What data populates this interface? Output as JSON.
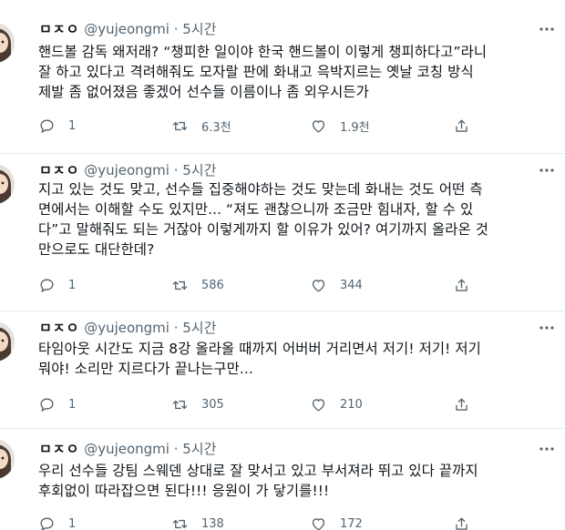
{
  "tweets": [
    {
      "display_name": "ㅁㅈㅇ",
      "handle_time": "@yujeongmi · 5시간",
      "text": "핸드볼 감독 왜저래? “챙피한 일이야 한국 핸드볼이 이렇게 챙피하다고”라니\n잘 하고 있다고 격려해줘도 모자랄 판에 화내고 윽박지르는 옛날 코칭 방식\n제발 좀 없어졌음 좋겠어 선수들 이름이나 좀 외우시든가",
      "replies": "1",
      "retweets": "6.3천",
      "likes": "1.9천"
    },
    {
      "display_name": "ㅁㅈㅇ",
      "handle_time": "@yujeongmi · 5시간",
      "text": "지고 있는 것도 맞고, 선수들 집중해야하는 것도 맞는데 화내는 것도 어떤 측\n면에서는 이해할 수도 있지만... “져도 괜찮으니까 조금만 힘내자, 할 수 있\n다”고 말해줘도 되는 거잖아 이렇게까지 할 이유가 있어? 여기까지 올라온 것\n만으로도 대단한데?",
      "replies": "1",
      "retweets": "586",
      "likes": "344"
    },
    {
      "display_name": "ㅁㅈㅇ",
      "handle_time": "@yujeongmi · 5시간",
      "text": "타임아웃 시간도 지금 8강 올라올 때까지 어버버 거리면서 저기! 저기! 저기\n뭐야! 소리만 지르다가 끝나는구만...",
      "replies": "1",
      "retweets": "305",
      "likes": "210"
    },
    {
      "display_name": "ㅁㅈㅇ",
      "handle_time": "@yujeongmi · 5시간",
      "text": "우리 선수들 강팀 스웨덴 상대로 잘 맞서고 있고 부서져라 뛰고 있다 끝까지\n후회없이 따라잡으면 된다!!! 응원이 가 닿기를!!!",
      "replies": "1",
      "retweets": "138",
      "likes": "172"
    }
  ],
  "icons": {
    "reply": "speech-bubble-icon",
    "retweet": "retweet-arrows-icon",
    "like": "heart-icon",
    "share": "share-upload-icon",
    "more": "ellipsis-icon"
  },
  "colors": {
    "text": "#0f1419",
    "muted": "#536471",
    "divider": "#e6ecf0"
  }
}
